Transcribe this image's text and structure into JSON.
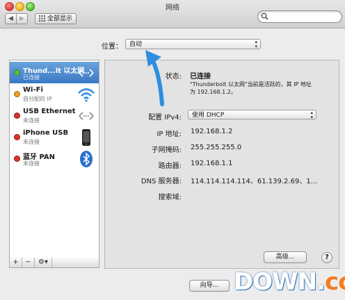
{
  "window": {
    "title": "网络"
  },
  "toolbar": {
    "back_glyph": "◀",
    "forward_glyph": "▶",
    "show_all_label": "全部显示",
    "search_placeholder": ""
  },
  "location": {
    "label": "位置：",
    "value": "自动"
  },
  "services": [
    {
      "name": "Thund...lt 以太网",
      "status": "已连接",
      "status_color": "#58c23b",
      "icon": "ethernet-arrows-icon",
      "selected": true
    },
    {
      "name": "Wi-Fi",
      "status": "自分配的 IP",
      "status_color": "#f0a020",
      "icon": "wifi-icon",
      "selected": false
    },
    {
      "name": "USB Ethernet",
      "status": "未连接",
      "status_color": "#d9302a",
      "icon": "ethernet-arrows-icon",
      "selected": false
    },
    {
      "name": "iPhone USB",
      "status": "未连接",
      "status_color": "#d9302a",
      "icon": "iphone-icon",
      "selected": false
    },
    {
      "name": "蓝牙 PAN",
      "status": "未连接",
      "status_color": "#d9302a",
      "icon": "bluetooth-icon",
      "selected": false
    }
  ],
  "sidebar_buttons": {
    "add": "+",
    "remove": "−",
    "gear": "⚙▾"
  },
  "detail": {
    "status_label": "状态:",
    "status_value": "已连接",
    "status_description_line1": "\"Thunderbolt 以太网\"当前是活跃的，其 IP 地址",
    "status_description_line2": "为 192.168.1.2。",
    "config_label": "配置 IPv4:",
    "config_value": "使用 DHCP",
    "ip_label": "IP 地址:",
    "ip_value": "192.168.1.2",
    "subnet_label": "子网掩码:",
    "subnet_value": "255.255.255.0",
    "router_label": "路由器:",
    "router_value": "192.168.1.1",
    "dns_label": "DNS 服务器:",
    "dns_value": "114.114.114.114、61.139.2.69、1...",
    "search_domain_label": "搜索域:",
    "advanced_button": "高级...",
    "help_button": "?"
  },
  "bottom": {
    "assistant_button": "向导..."
  },
  "watermark": {
    "text_main": "DOWN",
    "text_dot": ".",
    "text_cc": "cc"
  },
  "colors": {
    "selection_top": "#6aa3dc",
    "selection_bottom": "#3b79c4",
    "arrow": "#2d8ee0"
  }
}
